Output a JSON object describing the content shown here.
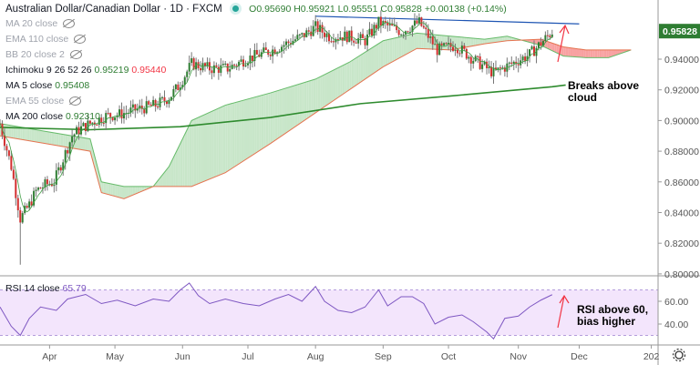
{
  "header": {
    "title": "Australian Dollar/Canadian Dollar · 1D · FXCM",
    "ohlc": "O0.95690 H0.95921 L0.95551 C0.95828 +0.00138 (+0.14%)"
  },
  "indicators": [
    {
      "label": "MA 20 close",
      "hidden": true
    },
    {
      "label": "EMA 110 close",
      "hidden": true
    },
    {
      "label": "BB 20 close 2",
      "hidden": true
    },
    {
      "label": "Ichimoku 9 26 52 26",
      "v1": "0.95219",
      "v2": "0.95440"
    },
    {
      "label": "MA 5 close",
      "v1": "0.95408"
    },
    {
      "label": "EMA 55 close",
      "hidden": true
    },
    {
      "label": "MA 200 close",
      "v1": "0.92310"
    }
  ],
  "rsi_label": {
    "label": "RSI 14 close",
    "value": "65.79"
  },
  "annotations": {
    "cloud": "Breaks above cloud",
    "rsi": "RSI above 60, bias higher"
  },
  "chart_data": {
    "type": "candlestick",
    "symbol": "AUDCAD",
    "current_price": "0.95828",
    "ylim": [
      0.795,
      0.97
    ],
    "y_ticks": [
      "0.94000",
      "0.92000",
      "0.90000",
      "0.88000",
      "0.86000",
      "0.84000",
      "0.82000",
      "0.80000"
    ],
    "x_ticks": [
      {
        "label": "Apr",
        "day": 22
      },
      {
        "label": "May",
        "day": 51
      },
      {
        "label": "Jun",
        "day": 81
      },
      {
        "label": "Jul",
        "day": 110
      },
      {
        "label": "Aug",
        "day": 140
      },
      {
        "label": "Sep",
        "day": 170
      },
      {
        "label": "Oct",
        "day": 199
      },
      {
        "label": "Nov",
        "day": 230
      },
      {
        "label": "Dec",
        "day": 257
      },
      {
        "label": "202",
        "day": 289
      }
    ],
    "close_path": [
      [
        0,
        0.898
      ],
      [
        5,
        0.87
      ],
      [
        9,
        0.836
      ],
      [
        13,
        0.845
      ],
      [
        16,
        0.854
      ],
      [
        20,
        0.858
      ],
      [
        24,
        0.86
      ],
      [
        28,
        0.875
      ],
      [
        32,
        0.89
      ],
      [
        36,
        0.895
      ],
      [
        40,
        0.898
      ],
      [
        47,
        0.903
      ],
      [
        53,
        0.904
      ],
      [
        60,
        0.907
      ],
      [
        69,
        0.91
      ],
      [
        75,
        0.915
      ],
      [
        79,
        0.922
      ],
      [
        85,
        0.937
      ],
      [
        93,
        0.934
      ],
      [
        101,
        0.934
      ],
      [
        109,
        0.94
      ],
      [
        121,
        0.946
      ],
      [
        134,
        0.955
      ],
      [
        140,
        0.961
      ],
      [
        146,
        0.955
      ],
      [
        154,
        0.955
      ],
      [
        162,
        0.952
      ],
      [
        168,
        0.964
      ],
      [
        178,
        0.958
      ],
      [
        186,
        0.964
      ],
      [
        194,
        0.946
      ],
      [
        202,
        0.949
      ],
      [
        210,
        0.94
      ],
      [
        219,
        0.931
      ],
      [
        227,
        0.937
      ],
      [
        235,
        0.943
      ],
      [
        245,
        0.958
      ]
    ],
    "ma200": [
      [
        0,
        0.8955
      ],
      [
        40,
        0.894
      ],
      [
        80,
        0.896
      ],
      [
        120,
        0.902
      ],
      [
        160,
        0.911
      ],
      [
        200,
        0.916
      ],
      [
        245,
        0.922
      ],
      [
        251,
        0.9231
      ]
    ],
    "cloud_span_a": [
      [
        0,
        0.898
      ],
      [
        20,
        0.893
      ],
      [
        40,
        0.888
      ],
      [
        45,
        0.86
      ],
      [
        55,
        0.857
      ],
      [
        68,
        0.857
      ],
      [
        75,
        0.87
      ],
      [
        85,
        0.9
      ],
      [
        100,
        0.91
      ],
      [
        120,
        0.918
      ],
      [
        140,
        0.927
      ],
      [
        155,
        0.938
      ],
      [
        170,
        0.952
      ],
      [
        185,
        0.957
      ],
      [
        200,
        0.955
      ],
      [
        215,
        0.953
      ],
      [
        225,
        0.955
      ],
      [
        240,
        0.949
      ],
      [
        250,
        0.942
      ],
      [
        260,
        0.941
      ],
      [
        270,
        0.941
      ],
      [
        280,
        0.946
      ]
    ],
    "cloud_span_b": [
      [
        0,
        0.89
      ],
      [
        20,
        0.885
      ],
      [
        40,
        0.88
      ],
      [
        45,
        0.853
      ],
      [
        55,
        0.849
      ],
      [
        68,
        0.857
      ],
      [
        75,
        0.857
      ],
      [
        85,
        0.857
      ],
      [
        100,
        0.866
      ],
      [
        120,
        0.885
      ],
      [
        140,
        0.905
      ],
      [
        155,
        0.92
      ],
      [
        170,
        0.935
      ],
      [
        185,
        0.947
      ],
      [
        200,
        0.946
      ],
      [
        215,
        0.95
      ],
      [
        225,
        0.952
      ],
      [
        240,
        0.953
      ],
      [
        250,
        0.948
      ],
      [
        260,
        0.946
      ],
      [
        270,
        0.946
      ],
      [
        280,
        0.946
      ]
    ],
    "trendline": [
      [
        140,
        0.968
      ],
      [
        257,
        0.963
      ]
    ],
    "rsi": {
      "levels": [
        70,
        30
      ],
      "ticks": [
        "60.00",
        "40.00"
      ],
      "values": [
        [
          0,
          55
        ],
        [
          5,
          38
        ],
        [
          9,
          30
        ],
        [
          13,
          45
        ],
        [
          18,
          55
        ],
        [
          25,
          52
        ],
        [
          30,
          62
        ],
        [
          38,
          66
        ],
        [
          45,
          58
        ],
        [
          52,
          61
        ],
        [
          60,
          56
        ],
        [
          68,
          62
        ],
        [
          75,
          60
        ],
        [
          80,
          70
        ],
        [
          84,
          76
        ],
        [
          88,
          65
        ],
        [
          93,
          58
        ],
        [
          100,
          62
        ],
        [
          108,
          58
        ],
        [
          115,
          56
        ],
        [
          122,
          62
        ],
        [
          128,
          66
        ],
        [
          134,
          60
        ],
        [
          140,
          73
        ],
        [
          144,
          60
        ],
        [
          150,
          52
        ],
        [
          156,
          50
        ],
        [
          162,
          55
        ],
        [
          168,
          70
        ],
        [
          172,
          56
        ],
        [
          178,
          64
        ],
        [
          183,
          64
        ],
        [
          188,
          58
        ],
        [
          193,
          40
        ],
        [
          199,
          46
        ],
        [
          205,
          48
        ],
        [
          210,
          42
        ],
        [
          216,
          33
        ],
        [
          219,
          27
        ],
        [
          224,
          45
        ],
        [
          230,
          47
        ],
        [
          235,
          55
        ],
        [
          240,
          61
        ],
        [
          245,
          65.8
        ]
      ]
    }
  }
}
